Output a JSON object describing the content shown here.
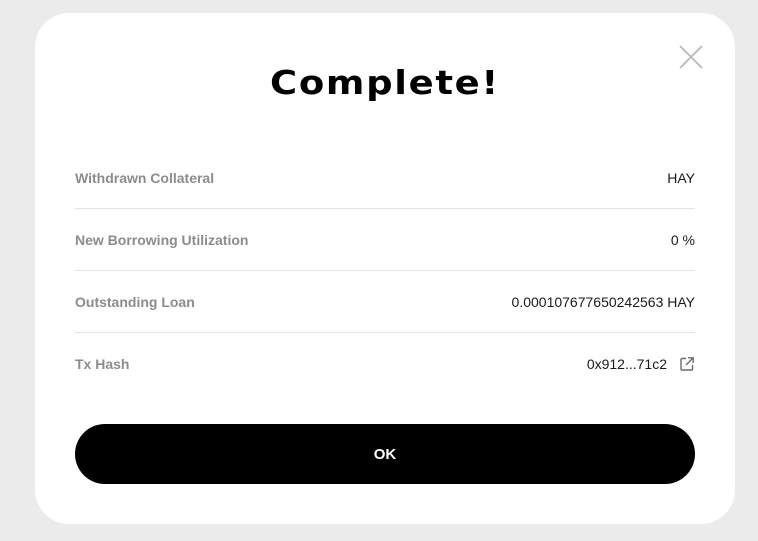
{
  "dialog": {
    "title": "Complete!",
    "ok_label": "OK"
  },
  "details": [
    {
      "label": "Withdrawn Collateral",
      "value": "HAY"
    },
    {
      "label": "New Borrowing Utilization",
      "value": "0 %"
    },
    {
      "label": "Outstanding Loan",
      "value": "0.000107677650242563 HAY"
    },
    {
      "label": "Tx Hash",
      "value": "0x912...71c2"
    }
  ],
  "icons": {
    "close": "close-icon",
    "external_link": "external-link-icon"
  }
}
